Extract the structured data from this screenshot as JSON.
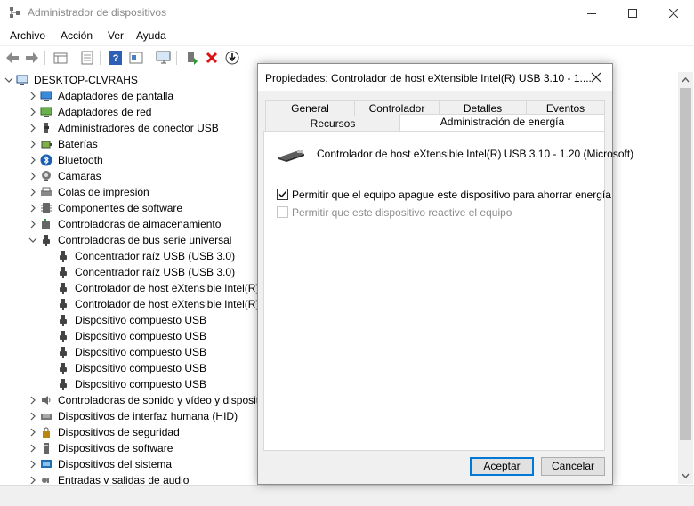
{
  "window": {
    "title": "Administrador de dispositivos",
    "buttons": [
      "minimize-icon",
      "maximize-icon",
      "close-icon"
    ]
  },
  "menu": [
    "Archivo",
    "Acción",
    "Ver",
    "Ayuda"
  ],
  "toolbar_icons": [
    "back-arrow-icon",
    "forward-arrow-icon",
    "properties-grid-icon",
    "properties-sheet-icon",
    "help-icon",
    "update-driver-icon",
    "scan-monitor-icon",
    "enable-device-icon",
    "uninstall-x-icon",
    "download-driver-icon"
  ],
  "tree": {
    "root": "DESKTOP-CLVRAHS",
    "items": [
      {
        "label": "Adaptadores de pantalla",
        "icon": "display-adapter-icon",
        "level": 1,
        "state": "collapsed"
      },
      {
        "label": "Adaptadores de red",
        "icon": "network-adapter-icon",
        "level": 1,
        "state": "collapsed"
      },
      {
        "label": "Administradores de conector USB",
        "icon": "usb-connector-icon",
        "level": 1,
        "state": "collapsed"
      },
      {
        "label": "Baterías",
        "icon": "battery-icon",
        "level": 1,
        "state": "collapsed"
      },
      {
        "label": "Bluetooth",
        "icon": "bluetooth-icon",
        "level": 1,
        "state": "collapsed"
      },
      {
        "label": "Cámaras",
        "icon": "camera-icon",
        "level": 1,
        "state": "collapsed"
      },
      {
        "label": "Colas de impresión",
        "icon": "printer-icon",
        "level": 1,
        "state": "collapsed"
      },
      {
        "label": "Componentes de software",
        "icon": "software-component-icon",
        "level": 1,
        "state": "collapsed"
      },
      {
        "label": "Controladoras de almacenamiento",
        "icon": "storage-controller-icon",
        "level": 1,
        "state": "collapsed"
      },
      {
        "label": "Controladoras de bus serie universal",
        "icon": "usb-plug-icon",
        "level": 1,
        "state": "expanded"
      },
      {
        "label": "Concentrador raíz USB (USB 3.0)",
        "icon": "usb-plug-icon",
        "level": 2,
        "state": "leaf"
      },
      {
        "label": "Concentrador raíz USB (USB 3.0)",
        "icon": "usb-plug-icon",
        "level": 2,
        "state": "leaf"
      },
      {
        "label": "Controlador de host eXtensible Intel(R)",
        "icon": "usb-plug-icon",
        "level": 2,
        "state": "leaf"
      },
      {
        "label": "Controlador de host eXtensible Intel(R)",
        "icon": "usb-plug-icon",
        "level": 2,
        "state": "leaf"
      },
      {
        "label": "Dispositivo compuesto USB",
        "icon": "usb-plug-icon",
        "level": 2,
        "state": "leaf"
      },
      {
        "label": "Dispositivo compuesto USB",
        "icon": "usb-plug-icon",
        "level": 2,
        "state": "leaf"
      },
      {
        "label": "Dispositivo compuesto USB",
        "icon": "usb-plug-icon",
        "level": 2,
        "state": "leaf"
      },
      {
        "label": "Dispositivo compuesto USB",
        "icon": "usb-plug-icon",
        "level": 2,
        "state": "leaf"
      },
      {
        "label": "Dispositivo compuesto USB",
        "icon": "usb-plug-icon",
        "level": 2,
        "state": "leaf"
      },
      {
        "label": "Controladoras de sonido y vídeo y dispositivos de juego",
        "icon": "speaker-icon",
        "level": 1,
        "state": "collapsed"
      },
      {
        "label": "Dispositivos de interfaz humana (HID)",
        "icon": "keyboard-icon",
        "level": 1,
        "state": "collapsed"
      },
      {
        "label": "Dispositivos de seguridad",
        "icon": "security-device-icon",
        "level": 1,
        "state": "collapsed"
      },
      {
        "label": "Dispositivos de software",
        "icon": "software-device-icon",
        "level": 1,
        "state": "collapsed"
      },
      {
        "label": "Dispositivos del sistema",
        "icon": "system-device-icon",
        "level": 1,
        "state": "collapsed"
      },
      {
        "label": "Entradas y salidas de audio",
        "icon": "audio-io-icon",
        "level": 1,
        "state": "collapsed"
      }
    ]
  },
  "dialog": {
    "title": "Propiedades: Controlador de host eXtensible Intel(R) USB 3.10 - 1....",
    "tabs_row1": [
      "General",
      "Controlador",
      "Detalles",
      "Eventos"
    ],
    "tabs_row2": [
      "Recursos",
      "Administración de energía"
    ],
    "active_tab": "Administración de energía",
    "device_name": "Controlador de host eXtensible Intel(R) USB 3.10 - 1.20 (Microsoft)",
    "options": [
      {
        "label": "Permitir que el equipo apague este dispositivo para ahorrar energía",
        "checked": true,
        "enabled": true
      },
      {
        "label": "Permitir que este dispositivo reactive el equipo",
        "checked": false,
        "enabled": false
      }
    ],
    "ok_label": "Aceptar",
    "cancel_label": "Cancelar"
  },
  "colors": {
    "accent": "#0078d7",
    "disabled_text": "#8d8d8d"
  }
}
